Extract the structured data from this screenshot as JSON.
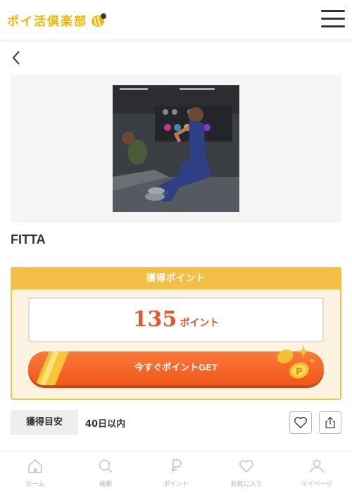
{
  "header": {
    "logo_text": "ポイ活倶楽部",
    "menu_icon": "hamburger-menu-icon"
  },
  "nav": {
    "back_icon": "chevron-left-icon"
  },
  "offer": {
    "title": "FITTA",
    "image": "fitness-class-photo"
  },
  "points": {
    "header_label": "獲得ポイント",
    "value": "135",
    "unit": "ポイント",
    "get_button_label": "今すぐポイントGET"
  },
  "estimate": {
    "label": "獲得目安",
    "value": "40日以内"
  },
  "actions": {
    "favorite_icon": "heart-icon",
    "share_icon": "share-icon"
  },
  "tabbar": {
    "items": [
      {
        "label": "ホーム",
        "icon": "home-icon"
      },
      {
        "label": "検索",
        "icon": "search-icon"
      },
      {
        "label": "ポイント",
        "icon": "point-icon"
      },
      {
        "label": "お気に入り",
        "icon": "heart-icon"
      },
      {
        "label": "マイページ",
        "icon": "user-icon"
      }
    ]
  },
  "colors": {
    "accent_orange": "#f2561c",
    "gold": "#f4bf46",
    "logo": "#f4b400"
  }
}
